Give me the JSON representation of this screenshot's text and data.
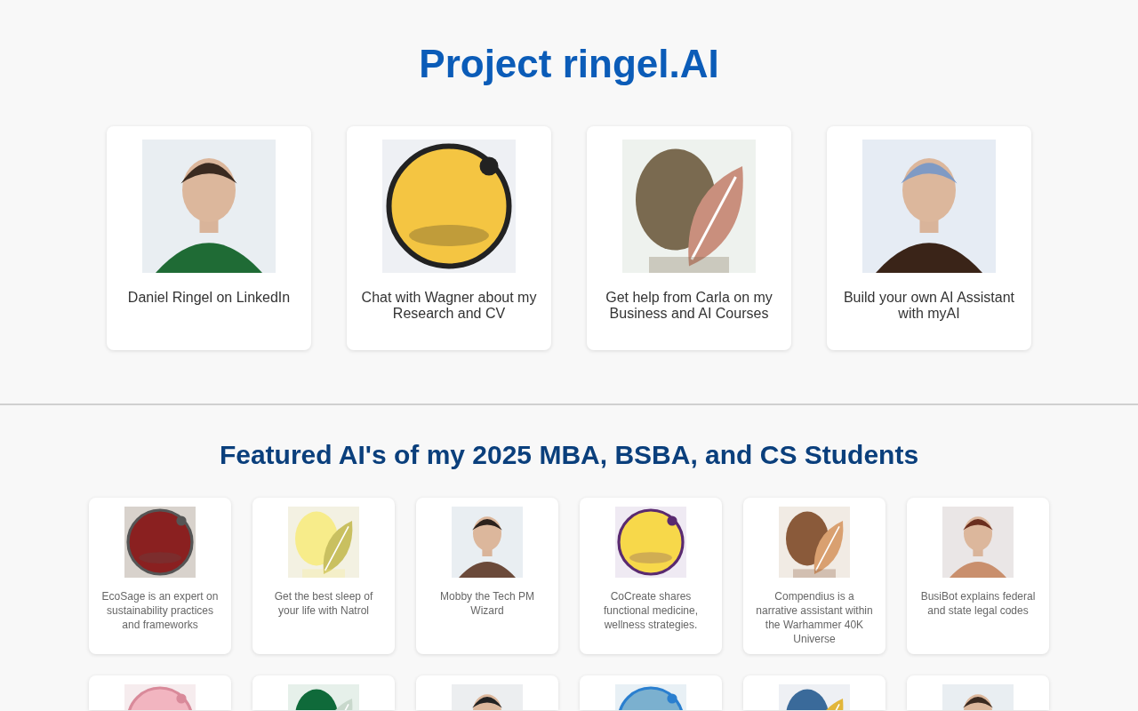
{
  "title": "Project ringel.AI",
  "main_cards": [
    {
      "label": "Daniel Ringel on LinkedIn"
    },
    {
      "label": "Chat with Wagner about my Research and CV"
    },
    {
      "label": "Get help from Carla on my Business and AI Courses"
    },
    {
      "label": "Build your own AI Assistant with myAI"
    }
  ],
  "featured_heading": "Featured AI's of my 2025 MBA, BSBA, and CS Students",
  "featured": [
    {
      "kind": "assistant",
      "description": "EcoSage is an expert on sustainability practices and frameworks"
    },
    {
      "kind": "assistant",
      "description": "Get the best sleep of your life with Natrol"
    },
    {
      "kind": "assistant",
      "description": "Mobby the Tech PM Wizard"
    },
    {
      "kind": "assistant",
      "description": "CoCreate shares functional medicine, wellness strategies."
    },
    {
      "kind": "assistant",
      "description": "Compendius is a narrative assistant within the Warhammer 40K Universe"
    },
    {
      "kind": "assistant",
      "description": "BusiBot explains federal and state legal codes"
    },
    {
      "kind": "picture"
    },
    {
      "kind": "picture"
    },
    {
      "kind": "picture"
    },
    {
      "kind": "picture"
    },
    {
      "kind": "picture"
    },
    {
      "kind": "picture"
    }
  ]
}
